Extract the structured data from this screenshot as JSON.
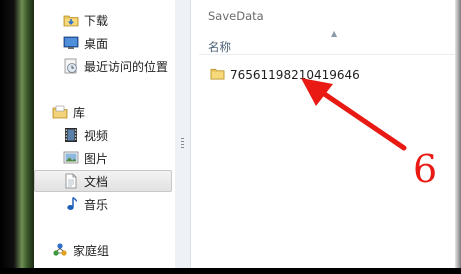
{
  "navigation": {
    "favorites": [
      {
        "label": "下载",
        "icon": "downloads-folder-icon"
      },
      {
        "label": "桌面",
        "icon": "desktop-icon"
      },
      {
        "label": "最近访问的位置",
        "icon": "recent-places-icon"
      }
    ],
    "libraries": {
      "label": "库",
      "icon": "libraries-icon",
      "items": [
        {
          "label": "视频",
          "icon": "videos-icon"
        },
        {
          "label": "图片",
          "icon": "pictures-icon"
        },
        {
          "label": "文档",
          "icon": "documents-icon",
          "selected": true
        },
        {
          "label": "音乐",
          "icon": "music-icon"
        }
      ]
    },
    "homegroup": {
      "label": "家庭组",
      "icon": "homegroup-icon"
    }
  },
  "content": {
    "folder_title": "SaveData",
    "column_header": "名称",
    "files": [
      {
        "name": "76561198210419646",
        "icon": "folder-icon"
      }
    ]
  },
  "annotation": {
    "step_number": "6",
    "color": "#e81a13"
  }
}
